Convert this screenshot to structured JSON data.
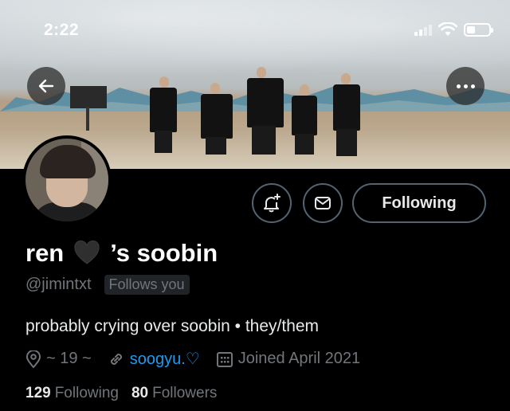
{
  "status_bar": {
    "time": "2:22"
  },
  "banner": {
    "description_icon": "photo-banner"
  },
  "header": {
    "back_icon": "arrow-left-icon",
    "more_icon": "more-horizontal-icon"
  },
  "actions": {
    "notify_icon": "bell-plus-icon",
    "message_icon": "envelope-icon",
    "following_label": "Following"
  },
  "profile": {
    "name_start": "ren",
    "name_emoji_icon": "black-heart-icon",
    "name_end": "’s soobin",
    "handle": "@jimintxt",
    "follows_you": "Follows you",
    "bio": "probably crying over soobin • they/them",
    "location": "~ 19 ~",
    "website": "soogyu.♡",
    "joined": "Joined April 2021",
    "following_count": "129",
    "following_label": "Following",
    "followers_count": "80",
    "followers_label": "Followers"
  },
  "colors": {
    "background": "#000000",
    "text_primary": "#e7e9ea",
    "text_secondary": "#71767b",
    "link": "#1d9bf0",
    "border": "#536471"
  }
}
